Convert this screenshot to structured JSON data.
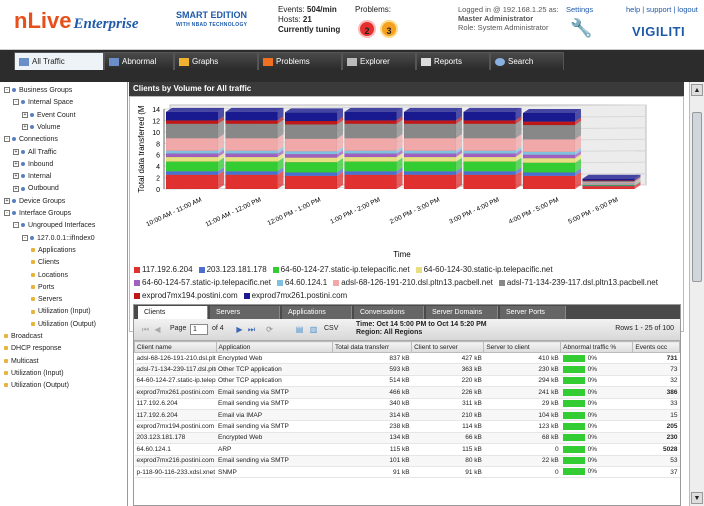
{
  "header": {
    "logo_main": "nLive",
    "logo_sub": "Enterprise",
    "edition": "SMART EDITION",
    "edition_sub": "WITH NBAD TECHNOLOGY",
    "events_label": "Events:",
    "events_value": "504/min",
    "hosts_label": "Hosts:",
    "hosts_value": "21",
    "tuning": "Currently tuning",
    "problems_label": "Problems:",
    "problem_red": "2",
    "problem_orange": "3",
    "logged_in": "Logged in @ 192.168.1.25 as:",
    "user": "Master Administrator",
    "role": "Role: System Administrator",
    "settings": "Settings",
    "help_links": "help | support | logout",
    "brand": "VIGILITI"
  },
  "tabs": [
    "All Traffic",
    "Abnormal Traffic",
    "Graphs",
    "Problems",
    "Explorer",
    "Reports",
    "Search"
  ],
  "tree": [
    {
      "label": "Business Groups",
      "lvl": 0,
      "t": "-"
    },
    {
      "label": "Internal Space",
      "lvl": 1,
      "t": "-"
    },
    {
      "label": "Event Count",
      "lvl": 2,
      "t": "+"
    },
    {
      "label": "Volume",
      "lvl": 2,
      "t": "+"
    },
    {
      "label": "Connections",
      "lvl": 0,
      "t": "-"
    },
    {
      "label": "All Traffic",
      "lvl": 1,
      "t": "+"
    },
    {
      "label": "Inbound",
      "lvl": 1,
      "t": "+"
    },
    {
      "label": "Internal",
      "lvl": 1,
      "t": "+"
    },
    {
      "label": "Outbound",
      "lvl": 1,
      "t": "+"
    },
    {
      "label": "Device Groups",
      "lvl": 0,
      "t": "+"
    },
    {
      "label": "Interface Groups",
      "lvl": 0,
      "t": "-"
    },
    {
      "label": "Ungrouped Interfaces",
      "lvl": 1,
      "t": "-"
    },
    {
      "label": "127.0.0.1::ifIndex0",
      "lvl": 2,
      "t": "-"
    },
    {
      "label": "Applications",
      "lvl": 3,
      "t": ""
    },
    {
      "label": "Clients",
      "lvl": 3,
      "t": ""
    },
    {
      "label": "Locations",
      "lvl": 3,
      "t": ""
    },
    {
      "label": "Ports",
      "lvl": 3,
      "t": ""
    },
    {
      "label": "Servers",
      "lvl": 3,
      "t": ""
    },
    {
      "label": "Utilization (Input)",
      "lvl": 3,
      "t": ""
    },
    {
      "label": "Utilization (Output)",
      "lvl": 3,
      "t": ""
    },
    {
      "label": "Broadcast",
      "lvl": 0,
      "t": ""
    },
    {
      "label": "DHCP response",
      "lvl": 0,
      "t": ""
    },
    {
      "label": "Multicast",
      "lvl": 0,
      "t": ""
    },
    {
      "label": "Utilization (Input)",
      "lvl": 0,
      "t": ""
    },
    {
      "label": "Utilization (Output)",
      "lvl": 0,
      "t": ""
    }
  ],
  "main_title": "Clients by Volume for All traffic",
  "chart_data": {
    "type": "bar",
    "stacked": true,
    "ylabel": "Total data transferred (M",
    "xlabel": "Time",
    "ylim": [
      0,
      14
    ],
    "yticks": [
      0,
      2,
      4,
      6,
      8,
      10,
      12,
      14
    ],
    "categories": [
      "10:00 AM - 11:00 AM",
      "11:00 AM - 12:00 PM",
      "12:00 PM - 1:00 PM",
      "1:00 PM - 2:00 PM",
      "2:00 PM - 3:00 PM",
      "3:00 PM - 4:00 PM",
      "4:00 PM - 5:00 PM",
      "5:00 PM - 6:00 PM"
    ],
    "series": [
      {
        "name": "117.192.6.204",
        "color": "#e03030",
        "values": [
          2.5,
          2.5,
          2.3,
          2.5,
          2.5,
          2.5,
          2.3,
          0.5
        ]
      },
      {
        "name": "203.123.181.178",
        "color": "#4a6fd0",
        "values": [
          0.6,
          0.6,
          0.6,
          0.6,
          0.6,
          0.6,
          0.6,
          0.1
        ]
      },
      {
        "name": "64-60-124-27.static-ip.telepacific.net",
        "color": "#33cc33",
        "values": [
          1.7,
          1.7,
          1.8,
          1.7,
          1.7,
          1.7,
          1.7,
          0.1
        ]
      },
      {
        "name": "64-60-124-30.static-ip.telepacific.net",
        "color": "#e8e080",
        "values": [
          0.8,
          0.8,
          0.8,
          0.8,
          0.8,
          0.8,
          0.8,
          0.1
        ]
      },
      {
        "name": "64-60-124-57.static-ip.telepacific.net",
        "color": "#a060c0",
        "values": [
          0.6,
          0.6,
          0.6,
          0.6,
          0.6,
          0.6,
          0.6,
          0.1
        ]
      },
      {
        "name": "64.60.124.1",
        "color": "#80c0e0",
        "values": [
          0.5,
          0.5,
          0.5,
          0.5,
          0.5,
          0.5,
          0.5,
          0.1
        ]
      },
      {
        "name": "adsl-68-126-191-210.dsl.pltn13.pacbell.net",
        "color": "#f0a8a8",
        "values": [
          2.2,
          2.2,
          2.2,
          2.2,
          2.2,
          2.2,
          2.2,
          0.2
        ]
      },
      {
        "name": "adsl-71-134-239-117.dsl.pltn13.pacbell.net",
        "color": "#888888",
        "values": [
          2.5,
          2.5,
          2.5,
          2.5,
          2.5,
          2.5,
          2.5,
          0.2
        ]
      },
      {
        "name": "exprod7mx194.postini.com",
        "color": "#c01818",
        "values": [
          0.6,
          0.6,
          0.6,
          0.6,
          0.6,
          0.6,
          0.6,
          0.1
        ]
      },
      {
        "name": "exprod7mx261.postini.com",
        "color": "#1a1a90",
        "values": [
          1.5,
          1.5,
          1.5,
          1.5,
          1.5,
          1.5,
          1.5,
          0.3
        ]
      }
    ]
  },
  "grid": {
    "tabs": [
      "Clients",
      "Servers",
      "Applications",
      "Conversations",
      "Server Domains",
      "Server Ports"
    ],
    "page_label": "Page",
    "page_value": "1",
    "of_label": "of 4",
    "csv": "CSV",
    "time_line": "Time: Oct 14 5:00 PM to Oct 14 5:20 PM",
    "region_line": "Region: All Regions",
    "rows_label": "Rows 1 - 25 of 100",
    "columns": [
      "Client name",
      "Application",
      "Total data transferr",
      "Client to server",
      "Server to client",
      "Abnormal traffic %",
      "Events occ"
    ],
    "rows": [
      [
        "adsl-68-126-191-210.dsl.pltn",
        "Encrypted Web",
        "837 kB",
        "427 kB",
        "410 kB",
        "0%",
        "731"
      ],
      [
        "adsl-71-134-239-117.dsl.pltn",
        "Other TCP application",
        "593 kB",
        "363 kB",
        "230 kB",
        "0%",
        "73"
      ],
      [
        "64-60-124-27.static-ip.telepa",
        "Other TCP application",
        "514 kB",
        "220 kB",
        "294 kB",
        "0%",
        "32"
      ],
      [
        "exprod7mx261.postini.com",
        "Email sending via SMTP",
        "466 kB",
        "226 kB",
        "241 kB",
        "0%",
        "386"
      ],
      [
        "117.192.6.204",
        "Email sending via SMTP",
        "340 kB",
        "311 kB",
        "29 kB",
        "0%",
        "33"
      ],
      [
        "117.192.6.204",
        "Email via IMAP",
        "314 kB",
        "210 kB",
        "104 kB",
        "0%",
        "15"
      ],
      [
        "exprod7mx194.postini.com",
        "Email sending via SMTP",
        "238 kB",
        "114 kB",
        "123 kB",
        "0%",
        "205"
      ],
      [
        "203.123.181.178",
        "Encrypted Web",
        "134 kB",
        "66 kB",
        "68 kB",
        "0%",
        "230"
      ],
      [
        "64.60.124.1",
        "ARP",
        "115 kB",
        "115 kB",
        "0",
        "0%",
        "5028"
      ],
      [
        "exprod7mx216.postini.com",
        "Email sending via SMTP",
        "101 kB",
        "80 kB",
        "22 kB",
        "0%",
        "53"
      ],
      [
        "p-118-90-116-233.xdsl.xnet",
        "SNMP",
        "91 kB",
        "91 kB",
        "0",
        "0%",
        "37"
      ]
    ]
  }
}
